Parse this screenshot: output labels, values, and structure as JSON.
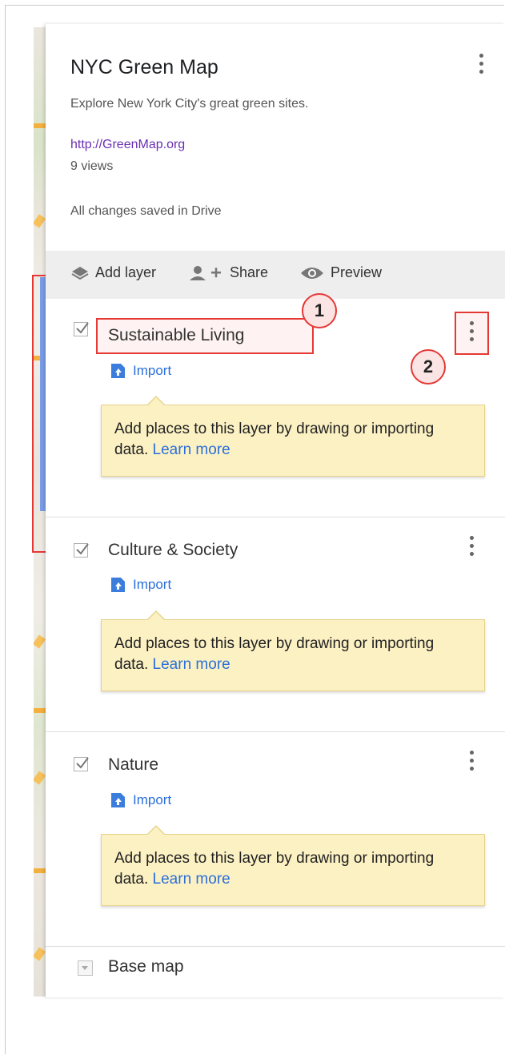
{
  "map": {
    "title": "NYC Green Map",
    "description": "Explore New York City's great green sites.",
    "link": "http://GreenMap.org",
    "views": "9 views",
    "save_status": "All changes saved in Drive"
  },
  "toolbar": {
    "add_layer": "Add layer",
    "share": "Share",
    "preview": "Preview"
  },
  "layers": [
    {
      "name": "Sustainable Living",
      "checked": true,
      "import_label": "Import",
      "tip_text": "Add places to this layer by drawing or importing data.",
      "tip_link": "Learn more"
    },
    {
      "name": "Culture & Society",
      "checked": true,
      "import_label": "Import",
      "tip_text": "Add places to this layer by drawing or importing data.",
      "tip_link": "Learn more"
    },
    {
      "name": "Nature",
      "checked": true,
      "import_label": "Import",
      "tip_text": "Add places to this layer by drawing or importing data.",
      "tip_link": "Learn more"
    }
  ],
  "base_map": {
    "label": "Base map"
  },
  "annotations": {
    "badge_1": "1",
    "badge_2": "2"
  },
  "colors": {
    "accent_link": "#2a6fdb",
    "visited_link": "#6b2fb3",
    "tooltip_bg": "#fcf1c3",
    "annotation_red": "#e53935",
    "toolbar_bg": "#eeeeee"
  },
  "icons": {
    "add_layer": "layers-icon",
    "share": "add-person-icon",
    "preview": "eye-icon",
    "import": "file-upload-icon",
    "menu": "more-vert-icon",
    "checkbox": "checkbox-checked-icon"
  }
}
